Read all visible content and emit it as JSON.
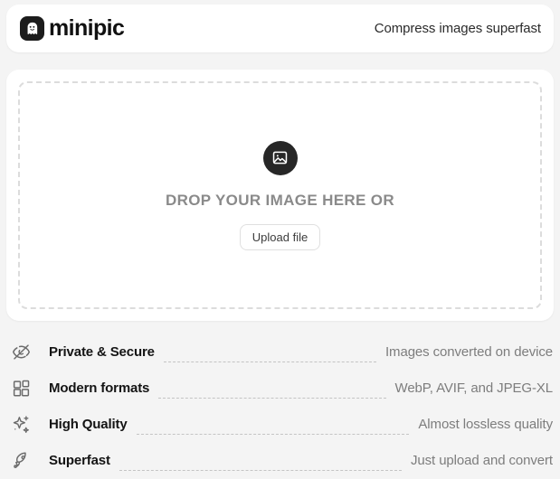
{
  "header": {
    "brand_name": "minipic",
    "logo_icon": "ghost-icon",
    "tagline": "Compress images superfast"
  },
  "dropzone": {
    "icon": "image-placeholder-icon",
    "prompt": "DROP YOUR IMAGE HERE OR",
    "upload_button": "Upload file"
  },
  "features": [
    {
      "icon": "eye-off-icon",
      "label": "Private & Secure",
      "value": "Images converted on device"
    },
    {
      "icon": "blocks-grid-icon",
      "label": "Modern formats",
      "value": "WebP, AVIF, and JPEG-XL"
    },
    {
      "icon": "sparkles-icon",
      "label": "High Quality",
      "value": "Almost lossless quality"
    },
    {
      "icon": "rocket-icon",
      "label": "Superfast",
      "value": "Just upload and convert"
    }
  ],
  "colors": {
    "page_background": "#f4f4f4",
    "card_background": "#ffffff",
    "logo_background": "#1c1c1c",
    "drop_icon_background": "#272727",
    "text_primary": "#111111",
    "text_muted": "#7d7d7d",
    "dashed_border": "#dcdcdc"
  }
}
